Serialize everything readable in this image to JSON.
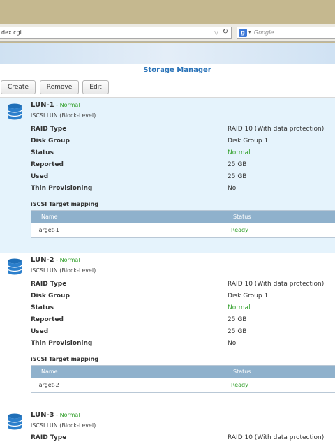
{
  "browser": {
    "url": "dex.cgi",
    "search_placeholder": "Google",
    "search_engine_icon": "google-icon"
  },
  "app": {
    "title": "Storage Manager",
    "toolbar": {
      "create": "Create",
      "remove": "Remove",
      "edit": "Edit"
    },
    "colors": {
      "accent": "#2a73b8",
      "status_green": "#33a02c",
      "selected_bg": "#e5f3fc",
      "table_header": "#8fb1cc"
    }
  },
  "labels": {
    "raid_type": "RAID Type",
    "disk_group": "Disk Group",
    "status": "Status",
    "reported": "Reported",
    "used": "Used",
    "thin_provisioning": "Thin Provisioning",
    "mapping_title": "iSCSI Target mapping",
    "col_name": "Name",
    "col_status": "Status"
  },
  "luns": [
    {
      "name": "LUN-1",
      "sep": " - ",
      "status": "Normal",
      "type": "iSCSI LUN (Block-Level)",
      "raid_type": "RAID 10 (With data protection)",
      "disk_group": "Disk Group 1",
      "status_value": "Normal",
      "reported": "25 GB",
      "used": "25 GB",
      "thin_provisioning": "No",
      "target": {
        "name": "Target-1",
        "status": "Ready"
      }
    },
    {
      "name": "LUN-2",
      "sep": " - ",
      "status": "Normal",
      "type": "iSCSI LUN (Block-Level)",
      "raid_type": "RAID 10 (With data protection)",
      "disk_group": "Disk Group 1",
      "status_value": "Normal",
      "reported": "25 GB",
      "used": "25 GB",
      "thin_provisioning": "No",
      "target": {
        "name": "Target-2",
        "status": "Ready"
      }
    },
    {
      "name": "LUN-3",
      "sep": " - ",
      "status": "Normal",
      "type": "iSCSI LUN (Block-Level)",
      "raid_type": "RAID 10 (With data protection)"
    }
  ]
}
